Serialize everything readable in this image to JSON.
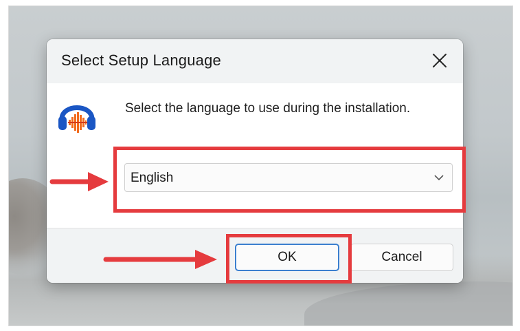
{
  "dialog": {
    "title": "Select Setup Language",
    "close_icon": "close-icon",
    "app_icon": "audacity-headphones-icon",
    "prompt": "Select the language to use during the installation.",
    "language_select": {
      "selected": "English",
      "chevron_icon": "chevron-down-icon"
    },
    "buttons": {
      "ok": "OK",
      "cancel": "Cancel"
    }
  },
  "annotations": {
    "color": "#e53b3e",
    "highlight_items": [
      "language-select",
      "ok-button"
    ]
  },
  "colors": {
    "titlebar_bg": "#f1f3f4",
    "focus_border": "#3b7fcf",
    "icon_blue": "#1a56c4",
    "icon_orange": "#f26b1d"
  }
}
